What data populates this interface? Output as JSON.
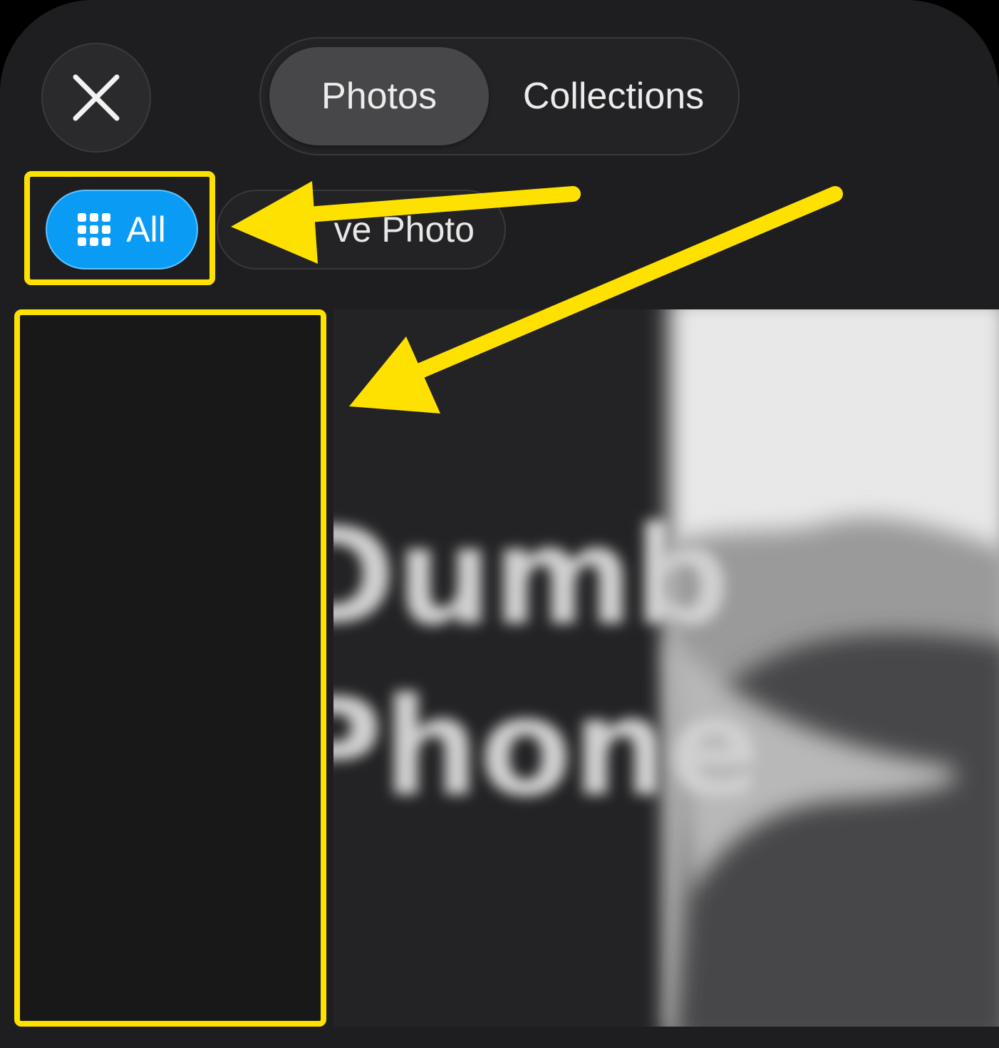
{
  "header": {
    "close_icon": "close-icon",
    "tabs": [
      {
        "label": "Photos",
        "selected": true
      },
      {
        "label": "Collections",
        "selected": false
      }
    ]
  },
  "filters": {
    "all": {
      "label": "All",
      "icon": "grid-icon",
      "selected": true,
      "color": "#0a9cf5"
    },
    "live_photo": {
      "label": "Live Photo",
      "visible_label": "ve Photo",
      "selected": false
    }
  },
  "photo": {
    "blurred_text_line1": "Dumb",
    "blurred_text_line2": "Phone"
  },
  "annotations": {
    "color": "#ffe100"
  }
}
